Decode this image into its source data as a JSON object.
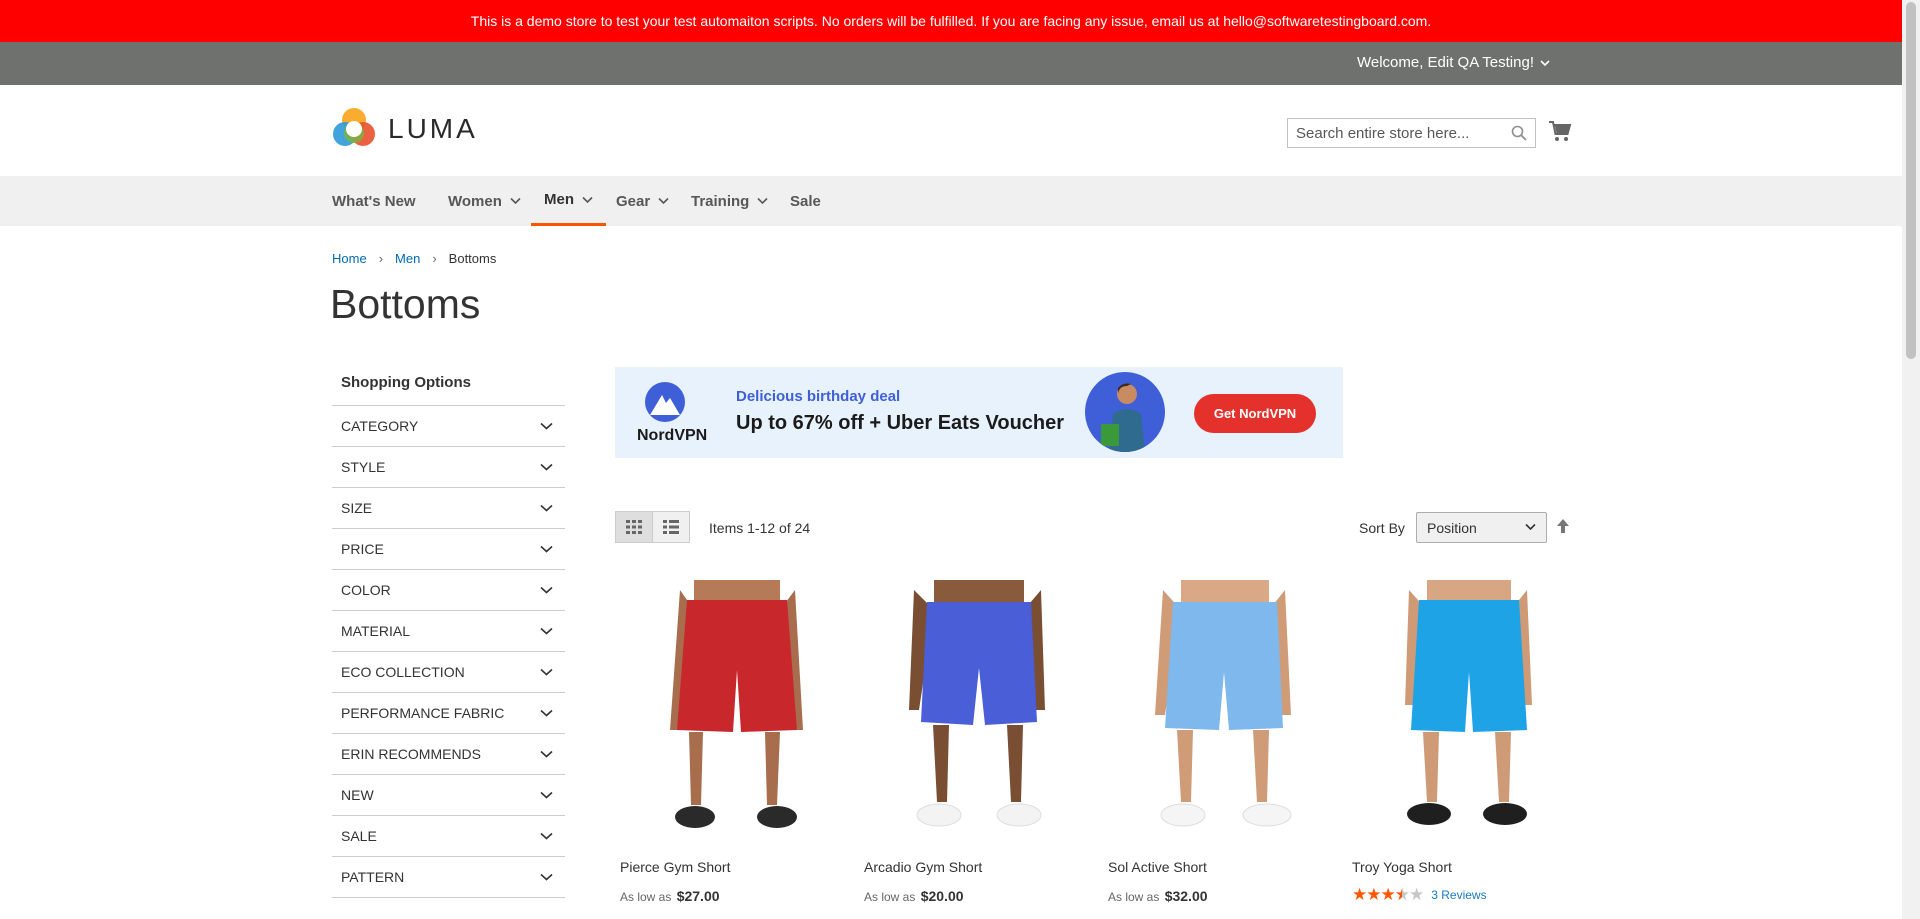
{
  "demo_banner": {
    "text": "This is a demo store to test your test automaiton scripts. No orders will be fulfilled. If you are facing any issue, email us at hello@softwaretestingboard.com."
  },
  "header": {
    "welcome": "Welcome, Edit QA Testing!",
    "logo_text": "LUMA",
    "search_placeholder": "Search entire store here...",
    "cart_icon": "cart-icon",
    "search_icon": "search-icon"
  },
  "nav": {
    "items": [
      {
        "label": "What's New",
        "has_dropdown": false
      },
      {
        "label": "Women",
        "has_dropdown": true
      },
      {
        "label": "Men",
        "has_dropdown": true,
        "active": true
      },
      {
        "label": "Gear",
        "has_dropdown": true
      },
      {
        "label": "Training",
        "has_dropdown": true
      },
      {
        "label": "Sale",
        "has_dropdown": false
      }
    ]
  },
  "breadcrumb": {
    "items": [
      "Home",
      "Men",
      "Bottoms"
    ]
  },
  "page_title": "Bottoms",
  "sidebar": {
    "title": "Shopping Options",
    "filters": [
      "CATEGORY",
      "STYLE",
      "SIZE",
      "PRICE",
      "COLOR",
      "MATERIAL",
      "ECO COLLECTION",
      "PERFORMANCE FABRIC",
      "ERIN RECOMMENDS",
      "NEW",
      "SALE",
      "PATTERN"
    ]
  },
  "ad": {
    "brand": "NordVPN",
    "subtitle": "Delicious birthday deal",
    "headline": "Up to 67% off + Uber Eats Voucher",
    "button": "Get NordVPN"
  },
  "toolbar": {
    "amount": "Items 1-12 of 24",
    "sort_label": "Sort By",
    "sort_value": "Position"
  },
  "products": [
    {
      "name": "Pierce Gym Short",
      "price_label": "As low as",
      "price": "$27.00",
      "color": "#c8282b"
    },
    {
      "name": "Arcadio Gym Short",
      "price_label": "As low as",
      "price": "$20.00",
      "color": "#4a5ed8"
    },
    {
      "name": "Sol Active Short",
      "price_label": "As low as",
      "price": "$32.00",
      "color": "#7fb8ec"
    },
    {
      "name": "Troy Yoga Short",
      "rating": 3.5,
      "reviews": "3  Reviews",
      "color": "#1ea3e6"
    }
  ],
  "colors": {
    "banner": "#ff0000",
    "topbar": "#6e716e",
    "accent": "#ff5501",
    "link": "#006bb4"
  }
}
